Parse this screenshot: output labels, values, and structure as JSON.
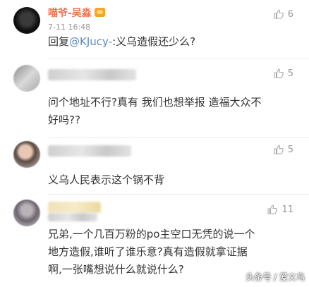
{
  "comments": [
    {
      "username": "喵爷-吴淼",
      "time": "7-11 16:48",
      "like_count": "6",
      "reply_prefix": "回复",
      "mention": "@KJucy-",
      "text": ":义乌造假还少么?"
    },
    {
      "like_count": "5",
      "lines": [
        "问个地址不行?真有 我们也想举报 造福大众不",
        "好吗??"
      ]
    },
    {
      "like_count": "5",
      "lines": [
        "义乌人民表示这个锅不背"
      ]
    },
    {
      "like_count": "11",
      "lines": [
        "兄弟,一个几百万粉的po主空口无凭的说一个",
        "地方造假,谁听了谁乐意?真有造假就拿证据",
        "啊,一张嘴想说什么就说什么?"
      ]
    }
  ],
  "icons": {
    "like": "thumbs-up-icon",
    "badge": "vip-crown-icon"
  },
  "watermark": "头条号 / 爱义乌"
}
